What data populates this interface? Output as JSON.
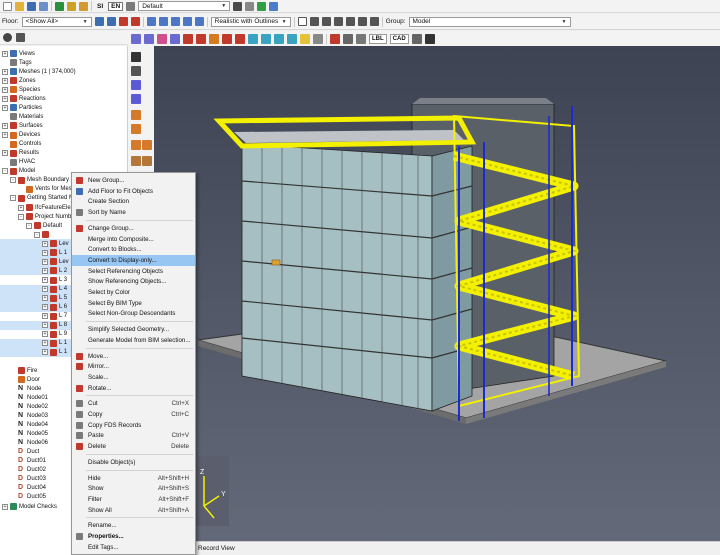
{
  "toolbar": {
    "si_label": "SI",
    "en_label": "EN",
    "view_combo": "Default",
    "render_combo": "Realistic with Outlines",
    "group_label": "Group:",
    "group_combo": "Model"
  },
  "floor_bar": {
    "floor_label": "Floor:",
    "floor_value": "<Show All>"
  },
  "viewport_tags": {
    "lbl": "LBL",
    "cad": "CAD"
  },
  "tree": [
    {
      "label": "Views",
      "indent": 0,
      "exp": "+",
      "icon": "ti-blue"
    },
    {
      "label": "Tags",
      "indent": 0,
      "exp": "",
      "icon": "ti-gray"
    },
    {
      "label": "Meshes (1 | 374,000)",
      "indent": 0,
      "exp": "+",
      "icon": "ti-blue"
    },
    {
      "label": "Zones",
      "indent": 0,
      "exp": "+",
      "icon": "ti-red"
    },
    {
      "label": "Species",
      "indent": 0,
      "exp": "+",
      "icon": "ti-orange"
    },
    {
      "label": "Reactions",
      "indent": 0,
      "exp": "+",
      "icon": "ti-red"
    },
    {
      "label": "Particles",
      "indent": 0,
      "exp": "+",
      "icon": "ti-blue"
    },
    {
      "label": "Materials",
      "indent": 0,
      "exp": "",
      "icon": "ti-gray"
    },
    {
      "label": "Surfaces",
      "indent": 0,
      "exp": "+",
      "icon": "ti-red"
    },
    {
      "label": "Devices",
      "indent": 0,
      "exp": "+",
      "icon": "ti-orange"
    },
    {
      "label": "Controls",
      "indent": 0,
      "exp": "",
      "icon": "ti-orange"
    },
    {
      "label": "Results",
      "indent": 0,
      "exp": "+",
      "icon": "ti-red"
    },
    {
      "label": "HVAC",
      "indent": 0,
      "exp": "",
      "icon": "ti-gray"
    },
    {
      "label": "Model",
      "indent": 0,
      "exp": "-",
      "icon": "ti-red"
    },
    {
      "label": "Mesh Boundary Vi",
      "indent": 1,
      "exp": "-",
      "icon": "ti-red"
    },
    {
      "label": "Vents for Mesh",
      "indent": 2,
      "exp": "",
      "icon": "ti-orange"
    },
    {
      "label": "Getting Started Mo",
      "indent": 1,
      "exp": "-",
      "icon": "ti-red"
    },
    {
      "label": "IfcFeatureElem",
      "indent": 2,
      "exp": "+",
      "icon": "ti-red"
    },
    {
      "label": "Project Numbe",
      "indent": 2,
      "exp": "-",
      "icon": "ti-red"
    },
    {
      "label": "Default",
      "indent": 3,
      "exp": "-",
      "icon": "ti-red"
    },
    {
      "label": "",
      "indent": 4,
      "exp": "-",
      "icon": "ti-red"
    },
    {
      "label": "Lev",
      "indent": 5,
      "exp": "+",
      "icon": "ti-red",
      "sel": true
    },
    {
      "label": "L 1",
      "indent": 5,
      "exp": "+",
      "icon": "ti-red",
      "sel": true
    },
    {
      "label": "Lev",
      "indent": 5,
      "exp": "+",
      "icon": "ti-red",
      "sel": true
    },
    {
      "label": "L 2",
      "indent": 5,
      "exp": "+",
      "icon": "ti-red",
      "sel": true
    },
    {
      "label": "L 3",
      "indent": 5,
      "exp": "+",
      "icon": "ti-red"
    },
    {
      "label": "L 4",
      "indent": 5,
      "exp": "+",
      "icon": "ti-red",
      "sel": true
    },
    {
      "label": "L 5",
      "indent": 5,
      "exp": "+",
      "icon": "ti-red",
      "sel": true
    },
    {
      "label": "L 6",
      "indent": 5,
      "exp": "+",
      "icon": "ti-red",
      "sel": true
    },
    {
      "label": "L 7",
      "indent": 5,
      "exp": "+",
      "icon": "ti-red"
    },
    {
      "label": "L 8",
      "indent": 5,
      "exp": "+",
      "icon": "ti-red",
      "sel": true
    },
    {
      "label": "L 9",
      "indent": 5,
      "exp": "+",
      "icon": "ti-red"
    },
    {
      "label": "L 1",
      "indent": 5,
      "exp": "+",
      "icon": "ti-red",
      "sel": true
    },
    {
      "label": "L 1",
      "indent": 5,
      "exp": "+",
      "icon": "ti-red",
      "sel": true
    },
    {
      "label": "",
      "indent": 1,
      "exp": "",
      "icon": ""
    },
    {
      "label": "Fire",
      "indent": 1,
      "exp": "",
      "icon": "ti-red"
    },
    {
      "label": "Door",
      "indent": 1,
      "exp": "",
      "icon": "ti-orange"
    },
    {
      "label": "Node",
      "indent": 1,
      "exp": "",
      "icon": "N"
    },
    {
      "label": "Node01",
      "indent": 1,
      "exp": "",
      "icon": "N"
    },
    {
      "label": "Node02",
      "indent": 1,
      "exp": "",
      "icon": "N"
    },
    {
      "label": "Node03",
      "indent": 1,
      "exp": "",
      "icon": "N"
    },
    {
      "label": "Node04",
      "indent": 1,
      "exp": "",
      "icon": "N"
    },
    {
      "label": "Node05",
      "indent": 1,
      "exp": "",
      "icon": "N"
    },
    {
      "label": "Node06",
      "indent": 1,
      "exp": "",
      "icon": "N"
    },
    {
      "label": "Duct",
      "indent": 1,
      "exp": "",
      "icon": "D"
    },
    {
      "label": "Duct01",
      "indent": 1,
      "exp": "",
      "icon": "D"
    },
    {
      "label": "Duct02",
      "indent": 1,
      "exp": "",
      "icon": "D"
    },
    {
      "label": "Duct03",
      "indent": 1,
      "exp": "",
      "icon": "D"
    },
    {
      "label": "Duct04",
      "indent": 1,
      "exp": "",
      "icon": "D"
    },
    {
      "label": "Duct05",
      "indent": 1,
      "exp": "",
      "icon": "D"
    },
    {
      "label": "Model Checks",
      "indent": 0,
      "exp": "+",
      "icon": "ti-green"
    }
  ],
  "context_menu": [
    {
      "label": "New Group...",
      "shortcut": "",
      "icon": "ti-red"
    },
    {
      "label": "Add Floor to Fit Objects",
      "shortcut": "",
      "icon": "ti-blue"
    },
    {
      "label": "Create Section",
      "shortcut": "",
      "icon": ""
    },
    {
      "label": "Sort by Name",
      "shortcut": "",
      "icon": "ti-gray"
    },
    {
      "sep": true
    },
    {
      "label": "Change Group...",
      "shortcut": "",
      "icon": "ti-red"
    },
    {
      "label": "Merge into Composite...",
      "shortcut": "",
      "icon": ""
    },
    {
      "label": "Convert to Blocks...",
      "shortcut": "",
      "icon": ""
    },
    {
      "label": "Convert to Display-only...",
      "shortcut": "",
      "icon": "",
      "hl": true
    },
    {
      "label": "Select Referencing Objects",
      "shortcut": "",
      "icon": ""
    },
    {
      "label": "Show Referencing Objects...",
      "shortcut": "",
      "icon": ""
    },
    {
      "label": "Select by Color",
      "shortcut": "",
      "icon": ""
    },
    {
      "label": "Select By BIM Type",
      "shortcut": "",
      "icon": ""
    },
    {
      "label": "Select Non-Group Descendants",
      "shortcut": "",
      "icon": ""
    },
    {
      "sep": true
    },
    {
      "label": "Simplify Selected Geometry...",
      "shortcut": "",
      "icon": ""
    },
    {
      "label": "Generate Model from BIM selection...",
      "shortcut": "",
      "icon": ""
    },
    {
      "sep": true
    },
    {
      "label": "Move...",
      "shortcut": "",
      "icon": "ti-red"
    },
    {
      "label": "Mirror...",
      "shortcut": "",
      "icon": "ti-red"
    },
    {
      "label": "Scale...",
      "shortcut": "",
      "icon": ""
    },
    {
      "label": "Rotate...",
      "shortcut": "",
      "icon": "ti-red"
    },
    {
      "sep": true
    },
    {
      "label": "Cut",
      "shortcut": "Ctrl+X",
      "icon": "ti-gray"
    },
    {
      "label": "Copy",
      "shortcut": "Ctrl+C",
      "icon": "ti-gray"
    },
    {
      "label": "Copy FDS Records",
      "shortcut": "",
      "icon": "ti-gray"
    },
    {
      "label": "Paste",
      "shortcut": "Ctrl+V",
      "icon": "ti-gray"
    },
    {
      "label": "Delete",
      "shortcut": "Delete",
      "icon": "ti-red"
    },
    {
      "sep": true
    },
    {
      "label": "Disable Object(s)",
      "shortcut": "",
      "icon": ""
    },
    {
      "sep": true
    },
    {
      "label": "Hide",
      "shortcut": "Alt+Shift+H",
      "icon": ""
    },
    {
      "label": "Show",
      "shortcut": "Alt+Shift+S",
      "icon": ""
    },
    {
      "label": "Filter",
      "shortcut": "Alt+Shift+F",
      "icon": ""
    },
    {
      "label": "Show All",
      "shortcut": "Alt+Shift+A",
      "icon": ""
    },
    {
      "sep": true
    },
    {
      "label": "Rename...",
      "shortcut": "",
      "icon": ""
    },
    {
      "label": "Properties...",
      "shortcut": "",
      "icon": "ti-gray",
      "bold": true
    },
    {
      "label": "Edit Tags...",
      "shortcut": "",
      "icon": ""
    }
  ],
  "status": {
    "record_view": "Record View"
  },
  "axis": {
    "z": "Z",
    "y": "Y"
  },
  "colors": {
    "highlight": "#98c6f2",
    "tree_select": "#cfe3f8",
    "stair_yellow": "#f3f000",
    "steel_blue": "#1b2bd0"
  }
}
